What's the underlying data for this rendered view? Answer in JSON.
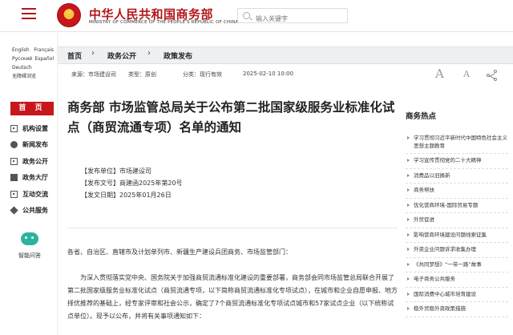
{
  "header": {
    "ministry_cn": "中华人民共和国商务部",
    "ministry_en": "MINISTRY OF COMMERCE OF THE PEOPLE'S REPUBLIC OF CHINA",
    "search_placeholder": "输入关键字"
  },
  "sidebar": {
    "languages": [
      [
        "English",
        "Français"
      ],
      [
        "Русский",
        "Español"
      ],
      [
        "Deutsch",
        ""
      ],
      [
        "无障碍浏览",
        ""
      ]
    ],
    "home": "首 页",
    "nav": [
      {
        "label": "机构设置",
        "icon": "org-icon"
      },
      {
        "label": "新闻发布",
        "icon": "news-icon"
      },
      {
        "label": "政务公开",
        "icon": "public-icon"
      },
      {
        "label": "政务大厅",
        "icon": "hall-icon"
      },
      {
        "label": "互动交流",
        "icon": "chat-icon"
      },
      {
        "label": "公共服务",
        "icon": "service-icon"
      }
    ],
    "assistant_label": "智能问答"
  },
  "breadcrumb": [
    "首页",
    "政务公开",
    "政策发布"
  ],
  "meta": {
    "source": "来源：市场建设司",
    "type": "类型：原创",
    "category": "分类：现行有效",
    "date": "2025-02-10 10:00"
  },
  "font_controls": {
    "large": "A",
    "small": "A"
  },
  "article": {
    "title": "商务部 市场监管总局关于公布第二批国家级服务业标准化试点（商贸流通专项）名单的通知",
    "issuer": "【发布单位】市场建设司",
    "doc_no": "【发布文号】商建函2025年第20号",
    "issue_date": "【发文日期】2025年01月26日",
    "recipients": "各省、自治区、直辖市及计划单列市、新疆生产建设兵团商务、市场监管部门：",
    "body": "为深入贯彻落实党中央、国务院关于加强商贸流通标准化建设的重要部署，商务部会同市场监管总局联合开展了第二批国家级服务业标准化试点（商贸流通专项，以下简称商贸流通标准化专项试点），在城市和企业自愿申报、地方择优推荐的基础上，经专家评审和社会公示，确定了7个商贸流通标准化专项试点城市和57家试点企业（以下统称试点单位）。现予以公布，并将有关事项通知如下："
  },
  "hot": {
    "title": "商务热点",
    "items": [
      "学习贯彻习近平新时代中国特色社会主义思想主题教育",
      "学习宣传贯彻党的二十大精神",
      "消费品以旧换新",
      "商务帮扶",
      "优化营商环境-国际贸易专题",
      "外贸促进",
      "影响营商环境建设问题线索征集",
      "外资企业问题诉求收集办理",
      "《共同梦想》“一带一路”故事",
      "电子商务公共服务",
      "国际消费中心城市培育建设",
      "稳外贸稳外资政策措施"
    ]
  }
}
